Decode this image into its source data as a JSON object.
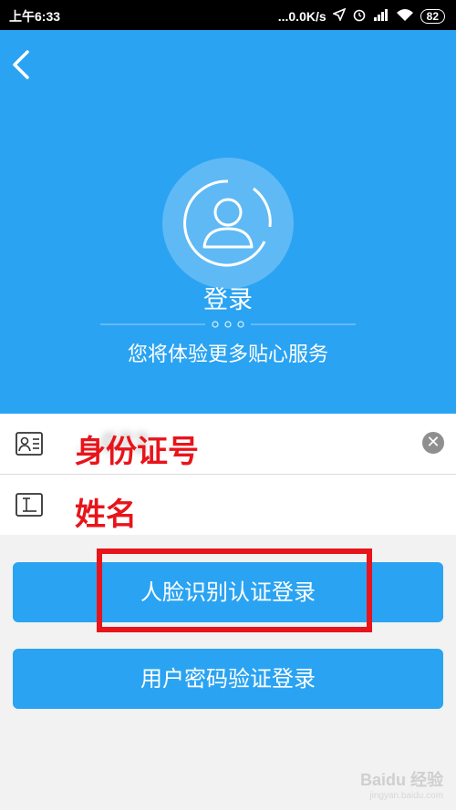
{
  "status_bar": {
    "time": "上午6:33",
    "network_speed": "...0.0K/s",
    "battery": "82"
  },
  "header": {
    "title": "登录",
    "subtitle": "您将体验更多贴心服务"
  },
  "form": {
    "id_field": {
      "value": "…072…",
      "annotation": "身份证号"
    },
    "name_field": {
      "value": "",
      "annotation": "姓名"
    }
  },
  "buttons": {
    "face_login": "人脸识别认证登录",
    "password_login": "用户密码验证登录"
  },
  "watermark": {
    "brand": "Baidu 经验",
    "url": "jingyan.baidu.com"
  },
  "colors": {
    "primary": "#2aa3f2",
    "annotation_red": "#e8141b"
  }
}
